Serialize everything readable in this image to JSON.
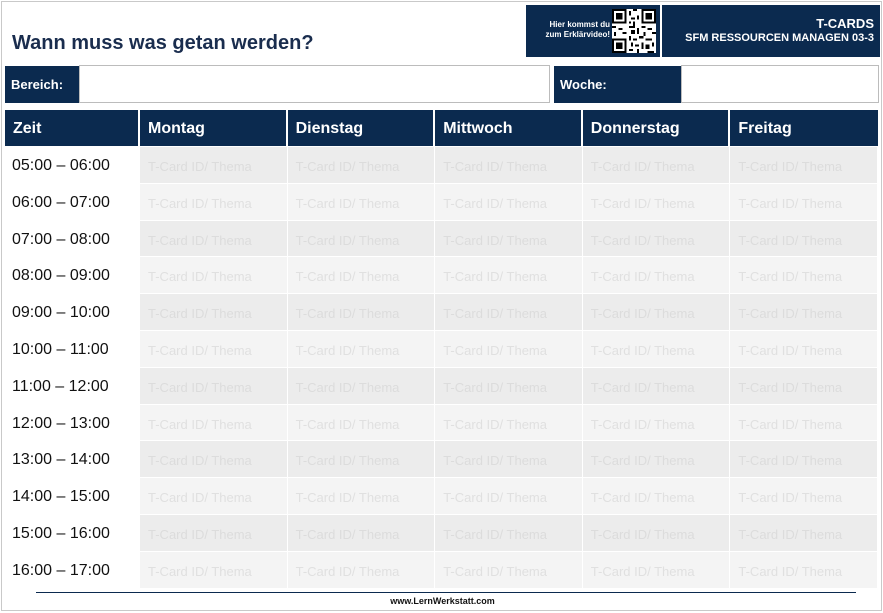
{
  "header": {
    "title": "Wann muss was getan werden?",
    "qr_caption_line1": "Hier kommst du",
    "qr_caption_line2": "zum Erklärvideo!",
    "brand_line1": "T-CARDS",
    "brand_line2": "SFM RESSOURCEN MANAGEN 03-3"
  },
  "fields": {
    "bereich_label": "Bereich:",
    "bereich_value": "",
    "woche_label": "Woche:",
    "woche_value": ""
  },
  "table": {
    "columns": [
      "Zeit",
      "Montag",
      "Dienstag",
      "Mittwoch",
      "Donnerstag",
      "Freitag"
    ],
    "placeholder": "T-Card ID/ Thema",
    "rows": [
      "05:00 – 06:00",
      "06:00 – 07:00",
      "07:00 – 08:00",
      "08:00 – 09:00",
      "09:00 – 10:00",
      "10:00 – 11:00",
      "11:00 – 12:00",
      "12:00 – 13:00",
      "13:00 – 14:00",
      "14:00 – 15:00",
      "15:00 – 16:00",
      "16:00 – 17:00"
    ]
  },
  "footer": {
    "url": "www.LernWerkstatt.com"
  },
  "colors": {
    "navy": "#0b2a4f",
    "title": "#1a2d4e",
    "cell_odd": "#ececec",
    "cell_even": "#f4f4f4"
  },
  "icons": {
    "qr": "qr-code-icon"
  }
}
